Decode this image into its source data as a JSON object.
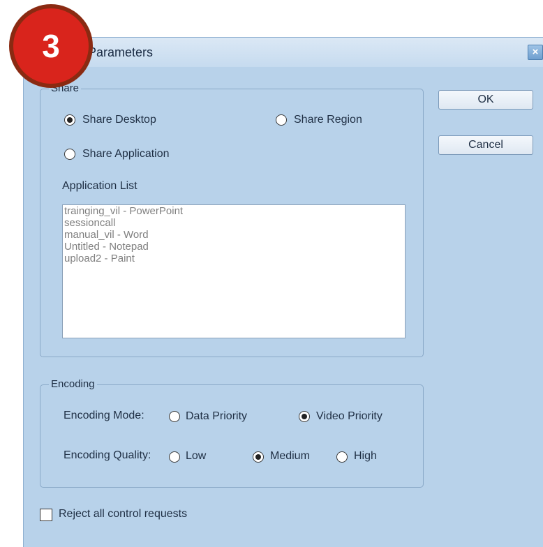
{
  "badge": {
    "number": "3"
  },
  "dialog": {
    "title": "Parameters",
    "close_icon": "×",
    "buttons": {
      "ok": "OK",
      "cancel": "Cancel"
    }
  },
  "share": {
    "legend": "Share",
    "options": [
      {
        "label": "Share Desktop",
        "selected": true
      },
      {
        "label": "Share Region",
        "selected": false
      },
      {
        "label": "Share Application",
        "selected": false
      }
    ],
    "list_label": "Application List",
    "applications": [
      "trainging_vil - PowerPoint",
      "sessioncall",
      "manual_vil - Word",
      "Untitled - Notepad",
      "upload2 - Paint"
    ]
  },
  "encoding": {
    "legend": "Encoding",
    "mode_label": "Encoding Mode:",
    "mode_options": [
      {
        "label": "Data Priority",
        "selected": false
      },
      {
        "label": "Video Priority",
        "selected": true
      }
    ],
    "quality_label": "Encoding Quality:",
    "quality_options": [
      {
        "label": "Low",
        "selected": false
      },
      {
        "label": "Medium",
        "selected": true
      },
      {
        "label": "High",
        "selected": false
      }
    ]
  },
  "reject": {
    "label": "Reject all control requests",
    "checked": false
  },
  "colors": {
    "dialog_bg": "#b8d2ea",
    "badge_red": "#d9241c"
  }
}
